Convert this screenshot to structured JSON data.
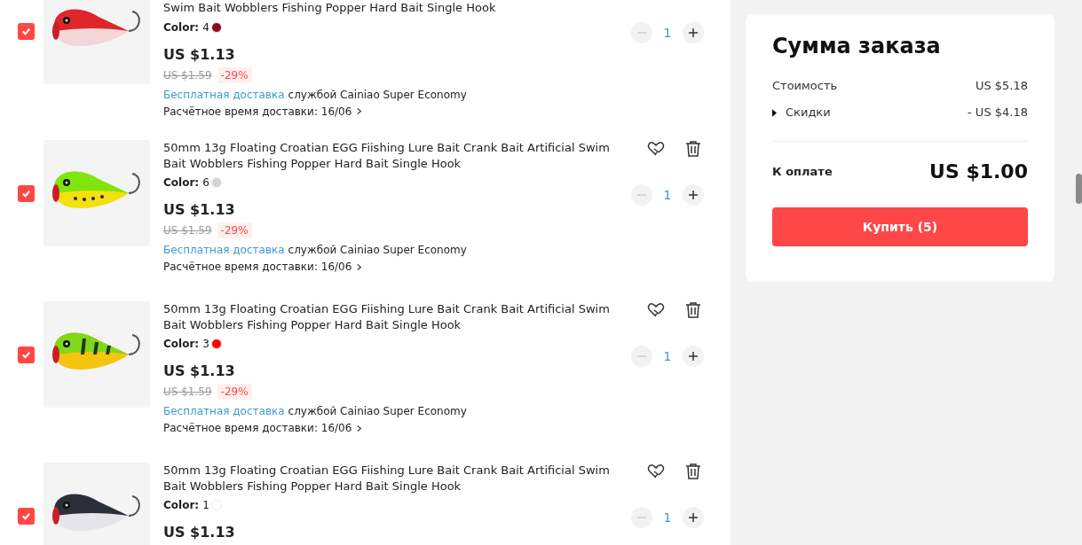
{
  "cart_items": [
    {
      "checked": true,
      "title": "Swim Bait Wobblers Fishing Popper Hard Bait Single Hook",
      "color_label": "Color:",
      "color_value": "4",
      "color": "#8b0a1e",
      "price": "US $1.13",
      "old_price": "US $1.59",
      "discount": "-29%",
      "shipping_link": "Бесплатная доставка",
      "shipping_text": "службой Cainiao Super Economy",
      "delivery": "Расчётное время доставки: 16/06",
      "quantity": "1"
    },
    {
      "checked": true,
      "title": "50mm 13g Floating Croatian EGG Fiishing Lure Bait Crank Bait Artificial Swim Bait Wobblers Fishing Popper Hard Bait Single Hook",
      "color_label": "Color:",
      "color_value": "6",
      "color": "#d4d4d4",
      "price": "US $1.13",
      "old_price": "US $1.59",
      "discount": "-29%",
      "shipping_link": "Бесплатная доставка",
      "shipping_text": "службой Cainiao Super Economy",
      "delivery": "Расчётное время доставки: 16/06",
      "quantity": "1"
    },
    {
      "checked": true,
      "title": "50mm 13g Floating Croatian EGG Fiishing Lure Bait Crank Bait Artificial Swim Bait Wobblers Fishing Popper Hard Bait Single Hook",
      "color_label": "Color:",
      "color_value": "3",
      "color": "#ff0000",
      "price": "US $1.13",
      "old_price": "US $1.59",
      "discount": "-29%",
      "shipping_link": "Бесплатная доставка",
      "shipping_text": "службой Cainiao Super Economy",
      "delivery": "Расчётное время доставки: 16/06",
      "quantity": "1"
    },
    {
      "checked": true,
      "title": "50mm 13g Floating Croatian EGG Fiishing Lure Bait Crank Bait Artificial Swim Bait Wobblers Fishing Popper Hard Bait Single Hook",
      "color_label": "Color:",
      "color_value": "1",
      "color": "#ffffff",
      "price": "US $1.13",
      "quantity": "1"
    }
  ],
  "summary": {
    "title": "Сумма заказа",
    "rows": [
      {
        "label": "Стоимость",
        "value": "US $5.18",
        "expandable": false
      },
      {
        "label": "Скидки",
        "value": "- US $4.18",
        "expandable": true
      }
    ],
    "total_label": "К оплате",
    "total_value": "US $1.00",
    "buy_button": "Купить (5)"
  }
}
